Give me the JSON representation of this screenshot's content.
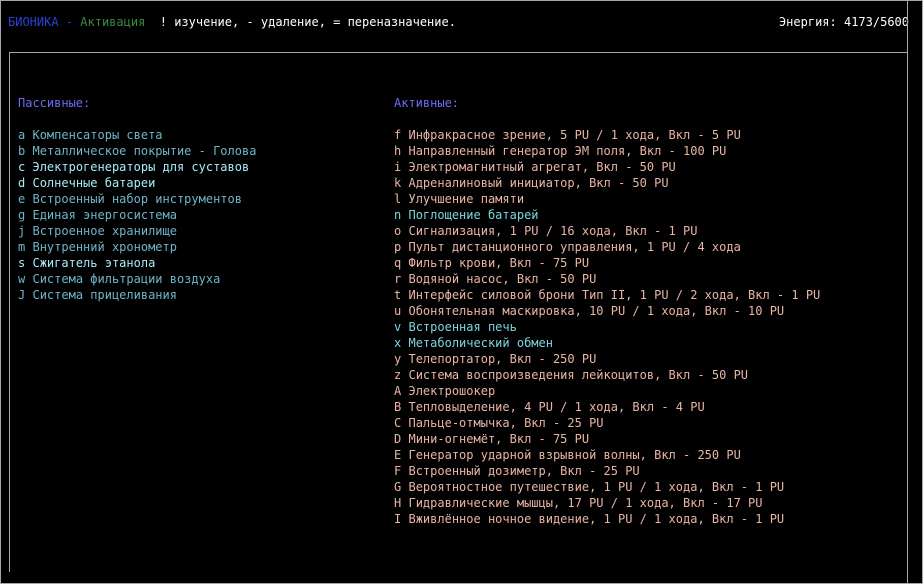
{
  "header": {
    "title": "БИОНИКА",
    "separator": " - ",
    "mode": "Активация",
    "hint": "  ! изучение, - удаление, = переназначение.",
    "energy": "Энергия: 4173/5600"
  },
  "passive": {
    "heading": "Пассивные:",
    "items": [
      {
        "key": "a",
        "label": "Компенсаторы света",
        "color": "#6fb4c8"
      },
      {
        "key": "b",
        "label": "Металлическое покрытие - Голова",
        "color": "#6fb4c8"
      },
      {
        "key": "c",
        "label": "Электрогенераторы для суставов",
        "color": "#a8ecf8"
      },
      {
        "key": "d",
        "label": "Солнечные батареи",
        "color": "#a8ecf8"
      },
      {
        "key": "e",
        "label": "Встроенный набор инструментов",
        "color": "#6fb4c8"
      },
      {
        "key": "g",
        "label": "Единая энергосистема",
        "color": "#6fb4c8"
      },
      {
        "key": "j",
        "label": "Встроенное хранилище",
        "color": "#6fb4c8"
      },
      {
        "key": "m",
        "label": "Внутренний хронометр",
        "color": "#6fb4c8"
      },
      {
        "key": "s",
        "label": "Сжигатель этанола",
        "color": "#a8ecf8"
      },
      {
        "key": "w",
        "label": "Система фильтрации воздуха",
        "color": "#6fb4c8"
      },
      {
        "key": "J",
        "label": "Система прицеливания",
        "color": "#6fb4c8"
      }
    ]
  },
  "active": {
    "heading": "Активные:",
    "items": [
      {
        "key": "f",
        "label": "Инфракрасное зрение, 5 PU / 1 хода, Вкл - 5 PU",
        "color": "#e8b4a4"
      },
      {
        "key": "h",
        "label": "Направленный генератор ЭМ поля, Вкл - 100 PU",
        "color": "#e8b4a4"
      },
      {
        "key": "i",
        "label": "Электромагнитный агрегат, Вкл - 50 PU",
        "color": "#e8b4a4"
      },
      {
        "key": "k",
        "label": "Адреналиновый инициатор, Вкл - 50 PU",
        "color": "#e8b4a4"
      },
      {
        "key": "l",
        "label": "Улучшение памяти",
        "color": "#e8b4a4"
      },
      {
        "key": "n",
        "label": "Поглощение батарей",
        "color": "#7fd4e0"
      },
      {
        "key": "o",
        "label": "Сигнализация, 1 PU / 16 хода, Вкл - 1 PU",
        "color": "#e8b4a4"
      },
      {
        "key": "p",
        "label": "Пульт дистанционного управления, 1 PU / 4 хода",
        "color": "#e8b4a4"
      },
      {
        "key": "q",
        "label": "Фильтр крови, Вкл - 75 PU",
        "color": "#e8b4a4"
      },
      {
        "key": "r",
        "label": "Водяной насос, Вкл - 50 PU",
        "color": "#e8b4a4"
      },
      {
        "key": "t",
        "label": "Интерфейс силовой брони Тип II, 1 PU / 2 хода, Вкл - 1 PU",
        "color": "#e8b4a4"
      },
      {
        "key": "u",
        "label": "Обонятельная маскировка, 10 PU / 1 хода, Вкл - 10 PU",
        "color": "#e8b4a4"
      },
      {
        "key": "v",
        "label": "Встроенная печь",
        "color": "#7fd4e0"
      },
      {
        "key": "x",
        "label": "Метаболический обмен",
        "color": "#7fd4e0"
      },
      {
        "key": "y",
        "label": "Телепортатор, Вкл - 250 PU",
        "color": "#e8b4a4"
      },
      {
        "key": "z",
        "label": "Система воспроизведения лейкоцитов, Вкл - 50 PU",
        "color": "#e8b4a4"
      },
      {
        "key": "A",
        "label": "Электрошокер",
        "color": "#e8b4a4"
      },
      {
        "key": "B",
        "label": "Тепловыделение, 4 PU / 1 хода, Вкл - 4 PU",
        "color": "#e8b4a4"
      },
      {
        "key": "C",
        "label": "Пальце-отмычка, Вкл - 25 PU",
        "color": "#e8b4a4"
      },
      {
        "key": "D",
        "label": "Мини-огнемёт, Вкл - 75 PU",
        "color": "#e8b4a4"
      },
      {
        "key": "E",
        "label": "Генератор ударной взрывной волны, Вкл - 250 PU",
        "color": "#e8b4a4"
      },
      {
        "key": "F",
        "label": "Встроенный дозиметр, Вкл - 25 PU",
        "color": "#e8b4a4"
      },
      {
        "key": "G",
        "label": "Вероятностное путешествие, 1 PU / 1 хода, Вкл - 1 PU",
        "color": "#e8b4a4"
      },
      {
        "key": "H",
        "label": "Гидравлические мышцы, 17 PU / 1 хода, Вкл - 17 PU",
        "color": "#e8b4a4"
      },
      {
        "key": "I",
        "label": "Вживлённое ночное видение, 1 PU / 1 хода, Вкл - 1 PU",
        "color": "#e8b4a4"
      }
    ]
  },
  "colors": {
    "title": "#2d3fd8",
    "mode": "#3c8a3c",
    "hint": "#ffffff",
    "energy": "#ffffff",
    "heading": "#6b6bf0",
    "border": "#a8a8a8"
  }
}
